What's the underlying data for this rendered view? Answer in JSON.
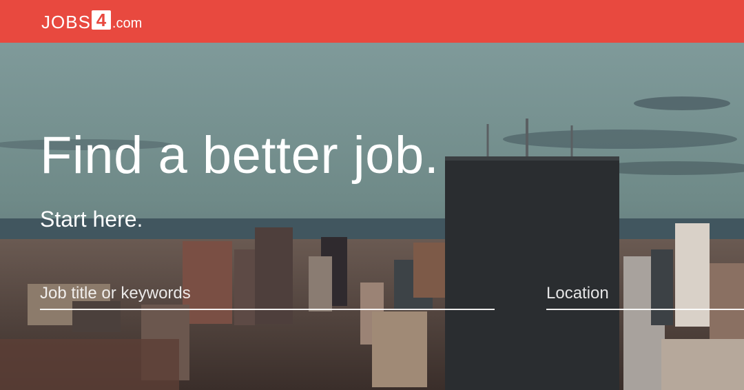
{
  "header": {
    "logo_prefix": "JOBS",
    "logo_number": "4",
    "logo_suffix": ".com",
    "background_color": "#e8493f"
  },
  "hero": {
    "headline": "Find a better job.",
    "subheadline": "Start here."
  },
  "search": {
    "keywords_placeholder": "Job title or keywords",
    "keywords_value": "",
    "location_placeholder": "Location",
    "location_value": ""
  }
}
